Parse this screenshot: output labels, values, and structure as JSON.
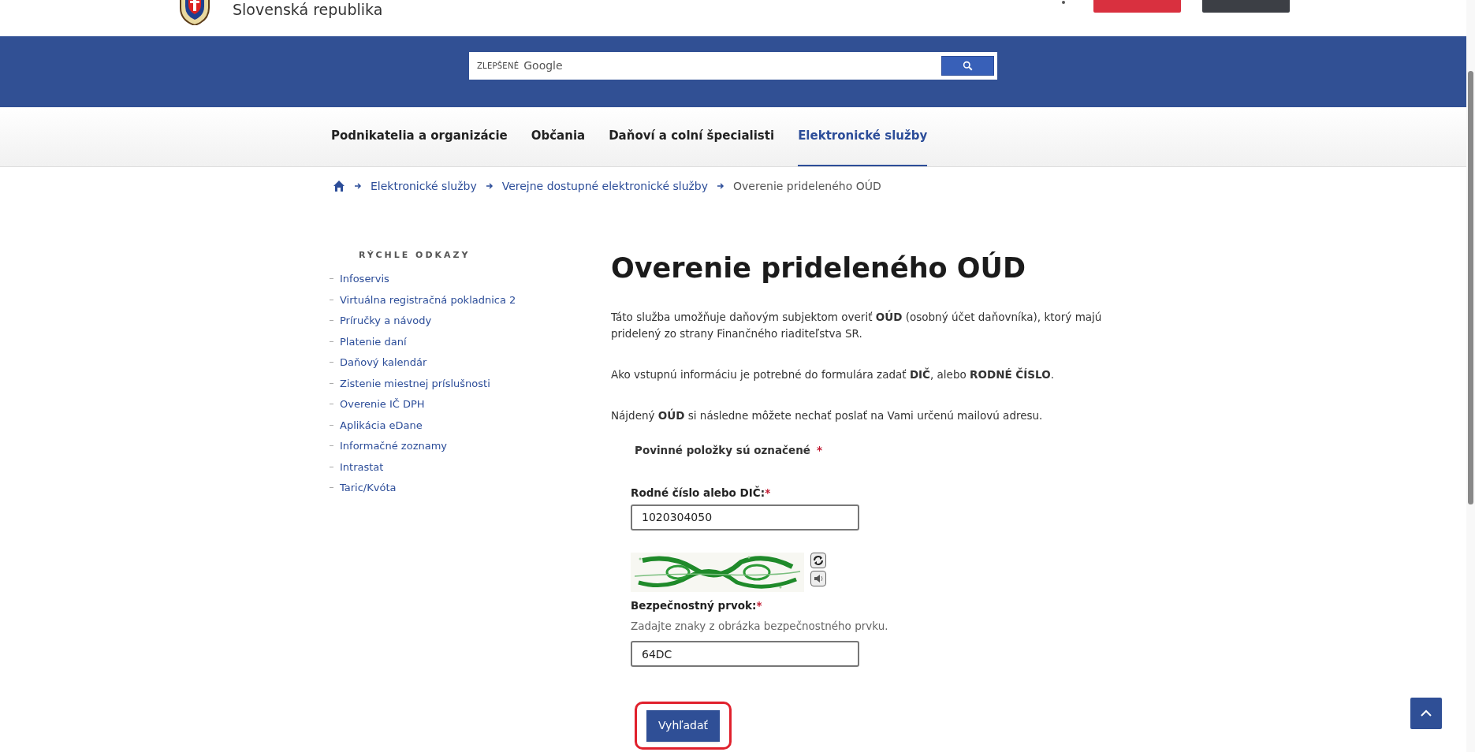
{
  "header": {
    "site_name": "Slovenská republika",
    "buttons": [
      {
        "kind": "primary"
      },
      {
        "kind": "dark"
      }
    ]
  },
  "search": {
    "placeholder_brand": "ZLEPŠENÉ",
    "placeholder": "Google"
  },
  "main_nav": [
    {
      "label": "Podnikatelia a organizácie",
      "selected": false
    },
    {
      "label": "Občania",
      "selected": false
    },
    {
      "label": "Daňoví a colní špecialisti",
      "selected": false
    },
    {
      "label": "Elektronické služby",
      "selected": true
    }
  ],
  "breadcrumb": [
    {
      "label": "Elektronické služby",
      "kind": "link"
    },
    {
      "label": "Verejne dostupné elektronické služby",
      "kind": "link"
    },
    {
      "label": "Overenie prideleného OÚD",
      "kind": "current"
    }
  ],
  "sidebar": {
    "title": "RÝCHLE ODKAZY",
    "items": [
      "Infoservis",
      "Virtuálna registračná pokladnica 2",
      "Príručky a návody",
      "Platenie daní",
      "Daňový kalendár",
      "Zistenie miestnej príslušnosti",
      "Overenie IČ DPH",
      "Aplikácia eDane",
      "Informačné zoznamy",
      "Intrastat",
      "Taric/Kvóta"
    ]
  },
  "page": {
    "title": "Overenie prideleného OÚD",
    "paragraphs": [
      "Táto služba umožňuje daňovým subjektom overiť  **OÚD** (osobný účet daňovníka), ktorý majú pridelený zo strany Finančného riaditeľstva SR.",
      "Ako vstupnú informáciu je potrebné do formulára zadať **DIČ**, alebo **RODNÉ ČÍSLO**.",
      "Nájdený **OÚD** si následne môžete nechať poslať na Vami určenú mailovú adresu."
    ],
    "required_note": "Povinné položky sú označené",
    "required_mark": "*"
  },
  "form": {
    "id_field": {
      "label": "Rodné číslo alebo DIČ:",
      "required": true,
      "value": "1020304050"
    },
    "captcha_field": {
      "label": "Bezpečnostný prvok:",
      "required": true,
      "hint": "Zadajte znaky z obrázka bezpečnostného prvku.",
      "value": "64DC"
    },
    "submit": {
      "label": "Vyhľadať",
      "highlighted": true
    }
  }
}
